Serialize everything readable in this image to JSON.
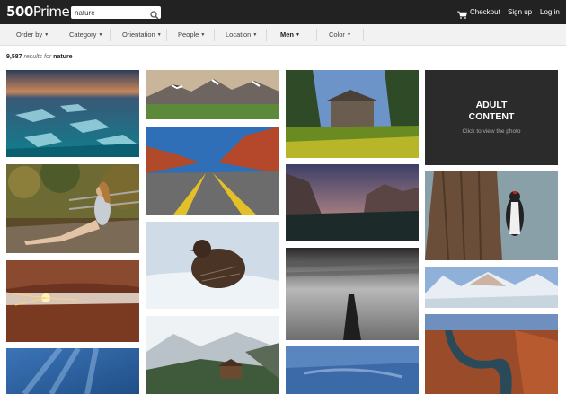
{
  "header": {
    "logo_num": "500",
    "logo_word": "Prime",
    "search_value": "nature",
    "checkout": "Checkout",
    "signup": "Sign up",
    "login": "Log in"
  },
  "filters": {
    "order_by": "Order by",
    "category": "Category",
    "orientation": "Orientation",
    "people": "People",
    "location": "Location",
    "men": "Men",
    "color": "Color"
  },
  "results": {
    "count": "9,587",
    "mid": "results for",
    "query": "nature"
  },
  "adult": {
    "title_line1": "ADULT",
    "title_line2": "CONTENT",
    "subtitle": "Click to view the photo"
  },
  "colors": {
    "topbar": "#222222",
    "filterbar": "#f2f2f2",
    "adult_bg": "#2b2b2b"
  }
}
